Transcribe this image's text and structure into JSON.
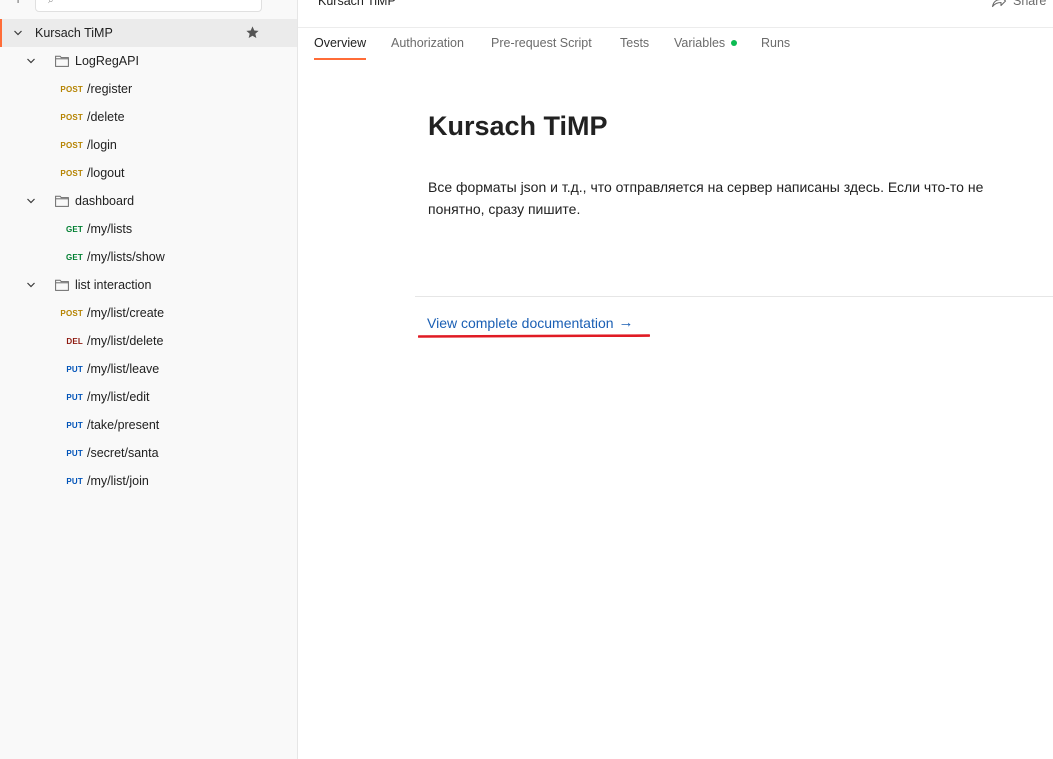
{
  "sidebar": {
    "items": [
      {
        "kind": "collection",
        "label": "Kursach TiMP"
      },
      {
        "kind": "folder",
        "label": "LogRegAPI"
      },
      {
        "kind": "request",
        "method": "POST",
        "label": "/register"
      },
      {
        "kind": "request",
        "method": "POST",
        "label": "/delete"
      },
      {
        "kind": "request",
        "method": "POST",
        "label": "/login"
      },
      {
        "kind": "request",
        "method": "POST",
        "label": "/logout"
      },
      {
        "kind": "folder",
        "label": "dashboard"
      },
      {
        "kind": "request",
        "method": "GET",
        "label": "/my/lists"
      },
      {
        "kind": "request",
        "method": "GET",
        "label": "/my/lists/show"
      },
      {
        "kind": "folder",
        "label": "list interaction"
      },
      {
        "kind": "request",
        "method": "POST",
        "label": "/my/list/create"
      },
      {
        "kind": "request",
        "method": "DEL",
        "label": "/my/list/delete"
      },
      {
        "kind": "request",
        "method": "PUT",
        "label": "/my/list/leave"
      },
      {
        "kind": "request",
        "method": "PUT",
        "label": "/my/list/edit"
      },
      {
        "kind": "request",
        "method": "PUT",
        "label": "/take/present"
      },
      {
        "kind": "request",
        "method": "PUT",
        "label": "/secret/santa"
      },
      {
        "kind": "request",
        "method": "PUT",
        "label": "/my/list/join"
      }
    ]
  },
  "header": {
    "title": "Kursach TiMP",
    "share_label": "Share"
  },
  "tabs": [
    {
      "label": "Overview"
    },
    {
      "label": "Authorization"
    },
    {
      "label": "Pre-request Script"
    },
    {
      "label": "Tests"
    },
    {
      "label": "Variables"
    },
    {
      "label": "Runs"
    }
  ],
  "overview": {
    "title": "Kursach TiMP",
    "description": "Все форматы json и т.д., что отправляется на сервер написаны здесь. Если что-то не понятно, сразу пишите.",
    "doc_link": "View complete documentation",
    "doc_link_arrow": "→"
  },
  "colors": {
    "accent": "#ff6c37",
    "post": "#b58300",
    "get": "#007f31",
    "del": "#8e1a10",
    "put": "#0053b8",
    "link": "#1a5fb4",
    "annotation": "#e01b24",
    "variables_dot": "#0cbb52"
  }
}
